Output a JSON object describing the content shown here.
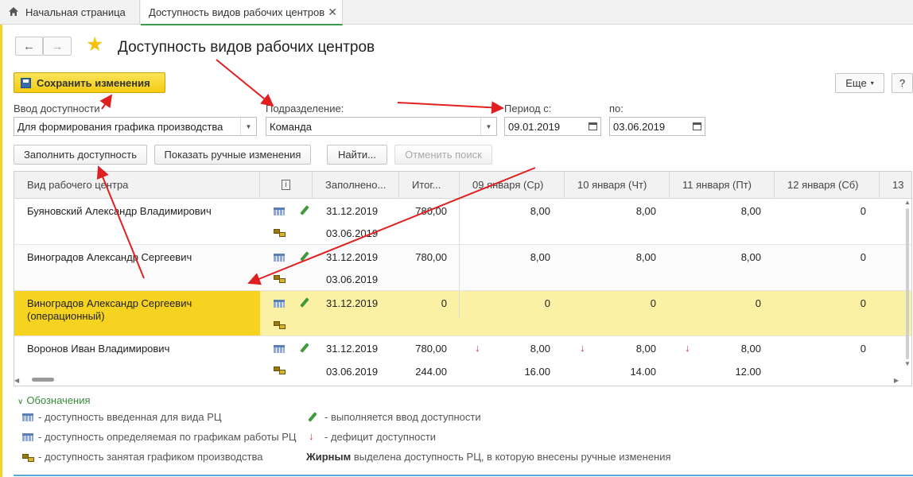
{
  "tabs": {
    "home": "Начальная страница",
    "active": "Доступность видов рабочих центров"
  },
  "toolbar": {
    "back": "←",
    "forward": "→",
    "title": "Доступность видов рабочих центров",
    "save": "Сохранить изменения",
    "more": "Еще",
    "help": "?"
  },
  "filters": {
    "mode_label": "Ввод доступности",
    "mode_value": "Для формирования графика производства",
    "division_label": "Подразделение:",
    "division_value": "Команда",
    "period_from_label": "Период с:",
    "period_from_value": "09.01.2019",
    "period_to_label": "по:",
    "period_to_value": "03.06.2019"
  },
  "actions": {
    "fill": "Заполнить доступность",
    "show_manual": "Показать ручные изменения",
    "find": "Найти...",
    "cancel_search": "Отменить поиск"
  },
  "grid": {
    "col_name": "Вид рабочего центра",
    "col_filled": "Заполнено...",
    "col_total": "Итог...",
    "col_d1": "09 января (Ср)",
    "col_d2": "10 января (Чт)",
    "col_d3": "11 января (Пт)",
    "col_d4": "12 января (Сб)",
    "col_d5": "13",
    "rows": [
      {
        "name": "Буяновский Александр Владимирович",
        "date1": "31.12.2019",
        "date2": "03.06.2019",
        "total": "780,00",
        "d1": "8,00",
        "d2": "8,00",
        "d3": "8,00",
        "d4": "0"
      },
      {
        "name": "Виноградов Александр Сергеевич",
        "date1": "31.12.2019",
        "date2": "03.06.2019",
        "total": "780,00",
        "d1": "8,00",
        "d2": "8,00",
        "d3": "8,00",
        "d4": "0"
      },
      {
        "name": "Виноградов Александр Сергеевич",
        "name2": "(операционный)",
        "date1": "31.12.2019",
        "total": "0",
        "d1": "0",
        "d2": "0",
        "d3": "0",
        "d4": "0"
      },
      {
        "name": "Воронов Иван Владимирович",
        "date1": "31.12.2019",
        "date2": "03.06.2019",
        "total": "780,00",
        "total2": "244.00",
        "d1": "8,00",
        "d1b": "16.00",
        "d2": "8,00",
        "d2b": "14.00",
        "d3": "8,00",
        "d3b": "12.00",
        "d4": "0"
      }
    ]
  },
  "legend": {
    "title": "Обозначения",
    "item1": "- доступность введенная для вида РЦ",
    "item2": "- доступность определяемая по графикам работы РЦ",
    "item3": "- доступность занятая графиком производства",
    "item4": "- выполняется ввод доступности",
    "item5": "- дефицит доступности",
    "item6_bold": "Жирным",
    "item6_rest": " выделена доступность РЦ, в которую внесены ручные изменения"
  },
  "colors": {
    "accent": "#f4cc10",
    "selected_row": "#fbf1a4",
    "annotation_arrow": "#e02020"
  }
}
